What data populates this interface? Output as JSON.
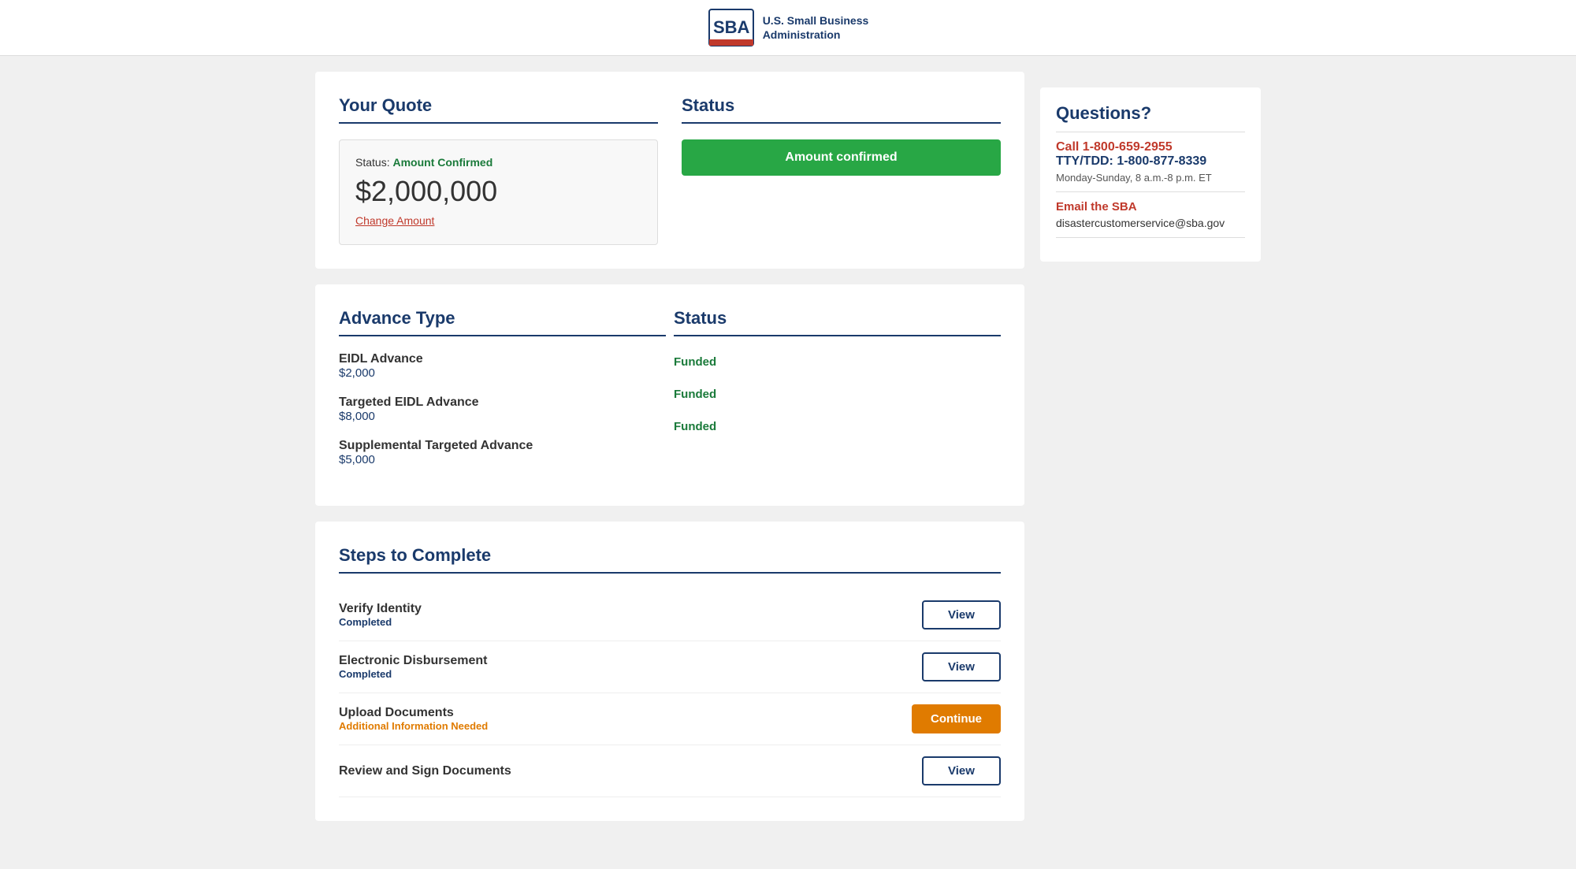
{
  "header": {
    "logo_text_line1": "U.S. Small Business",
    "logo_text_line2": "Administration"
  },
  "quote_section": {
    "title": "Your Quote",
    "status_label": "Status:",
    "status_value": "Amount Confirmed",
    "amount": "$2,000,000",
    "change_amount_label": "Change Amount",
    "status_section_title": "Status",
    "amount_confirmed_btn": "Amount confirmed"
  },
  "advance_section": {
    "title": "Advance Type",
    "status_title": "Status",
    "items": [
      {
        "name": "EIDL Advance",
        "amount": "$2,000",
        "status": "Funded"
      },
      {
        "name": "Targeted EIDL Advance",
        "amount": "$8,000",
        "status": "Funded"
      },
      {
        "name": "Supplemental Targeted Advance",
        "amount": "$5,000",
        "status": "Funded"
      }
    ]
  },
  "steps_section": {
    "title": "Steps to Complete",
    "steps": [
      {
        "name": "Verify Identity",
        "sub_status": "Completed",
        "sub_status_type": "completed",
        "btn_label": "View",
        "btn_type": "view"
      },
      {
        "name": "Electronic Disbursement",
        "sub_status": "Completed",
        "sub_status_type": "completed",
        "btn_label": "View",
        "btn_type": "view"
      },
      {
        "name": "Upload Documents",
        "sub_status": "Additional Information Needed",
        "sub_status_type": "info",
        "btn_label": "Continue",
        "btn_type": "continue"
      },
      {
        "name": "Review and Sign Documents",
        "sub_status": "",
        "sub_status_type": "",
        "btn_label": "View",
        "btn_type": "view"
      }
    ]
  },
  "sidebar": {
    "questions_title": "Questions?",
    "phone_label": "Call 1-800-659-2955",
    "tty_label": "TTY/TDD: 1-800-877-8339",
    "hours": "Monday-Sunday, 8 a.m.-8 p.m. ET",
    "email_label": "Email the SBA",
    "email_address": "disastercustomerservice@sba.gov"
  }
}
